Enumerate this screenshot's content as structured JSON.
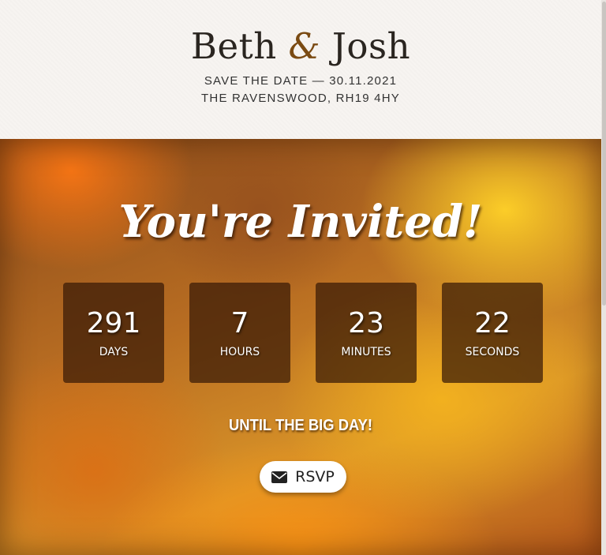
{
  "header": {
    "name1": "Beth",
    "amp": "&",
    "name2": "Josh",
    "save_the_date": "SAVE THE DATE — 30.11.2021",
    "venue": "THE RAVENSWOOD, RH19 4HY"
  },
  "hero": {
    "heading": "You're Invited!",
    "countdown": [
      {
        "value": "291",
        "label": "DAYS"
      },
      {
        "value": "7",
        "label": "HOURS"
      },
      {
        "value": "23",
        "label": "MINUTES"
      },
      {
        "value": "22",
        "label": "SECONDS"
      }
    ],
    "until_text": "UNTIL THE BIG DAY!",
    "rsvp_label": "RSVP",
    "rsvp_icon": "envelope-icon"
  },
  "colors": {
    "accent": "#7a4a12",
    "header_bg": "#f7f4f1",
    "box_bg": "#37190580"
  }
}
